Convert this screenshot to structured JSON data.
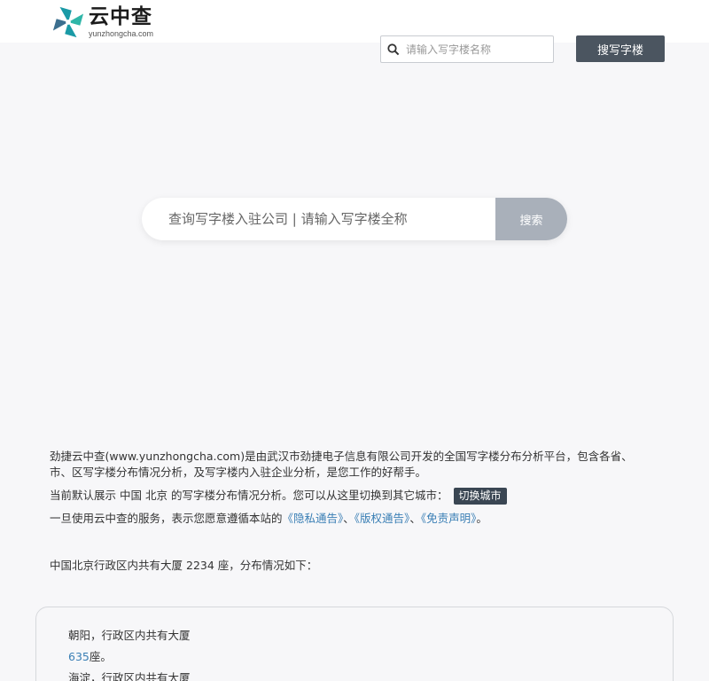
{
  "brand": {
    "name": "云中查",
    "url": "yunzhongcha.com"
  },
  "header": {
    "search_placeholder": "请输入写字楼名称",
    "search_button": "搜写字楼"
  },
  "hero": {
    "search_placeholder": "查询写字楼入驻公司 | 请输入写字楼全称",
    "search_button": "搜索"
  },
  "intro": {
    "line1": "劲捷云中查(www.yunzhongcha.com)是由武汉市劲捷电子信息有限公司开发的全国写字楼分布分析平台，包含各省、市、区写字楼分布情况分析，及写字楼内入驻企业分析，是您工作的好帮手。",
    "line2_prefix": "当前默认展示",
    "country": "中国",
    "city": "北京",
    "line2_suffix": "的写字楼分布情况分析。您可以从这里切换到其它城市：",
    "switch_city": "切换城市",
    "line3_prefix": "一旦使用云中查的服务，表示您愿意遵循本站的",
    "privacy": "《隐私通告》",
    "sep1": "、",
    "copyright": "《版权通告》",
    "sep2": "、",
    "disclaimer": "《免责声明》",
    "line3_suffix": "。"
  },
  "summary": {
    "prefix": "中国北京行政区内共有大厦",
    "count": "2234",
    "suffix": "座，分布情况如下："
  },
  "districts": [
    {
      "prefix": "朝阳，行政区内共有大厦",
      "count": "635",
      "suffix": "座。"
    },
    {
      "prefix": "海淀，行政区内共有大厦",
      "count": "",
      "suffix": ""
    }
  ],
  "colors": {
    "header_button": "#4b5560",
    "search_button": "#a9b0ba",
    "link": "#3a7fb5",
    "city_button": "#3a4653"
  }
}
